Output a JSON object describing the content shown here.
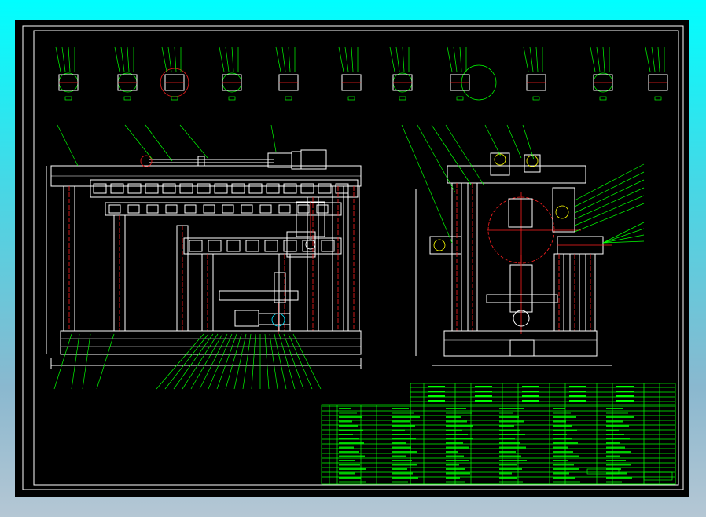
{
  "drawing": {
    "background": "#000000",
    "line_colors": {
      "outline": "#ffffff",
      "leader": "#00ff00",
      "center": "#ff2020",
      "hidden": "#00e5ff",
      "accent": "#ffff00"
    }
  }
}
